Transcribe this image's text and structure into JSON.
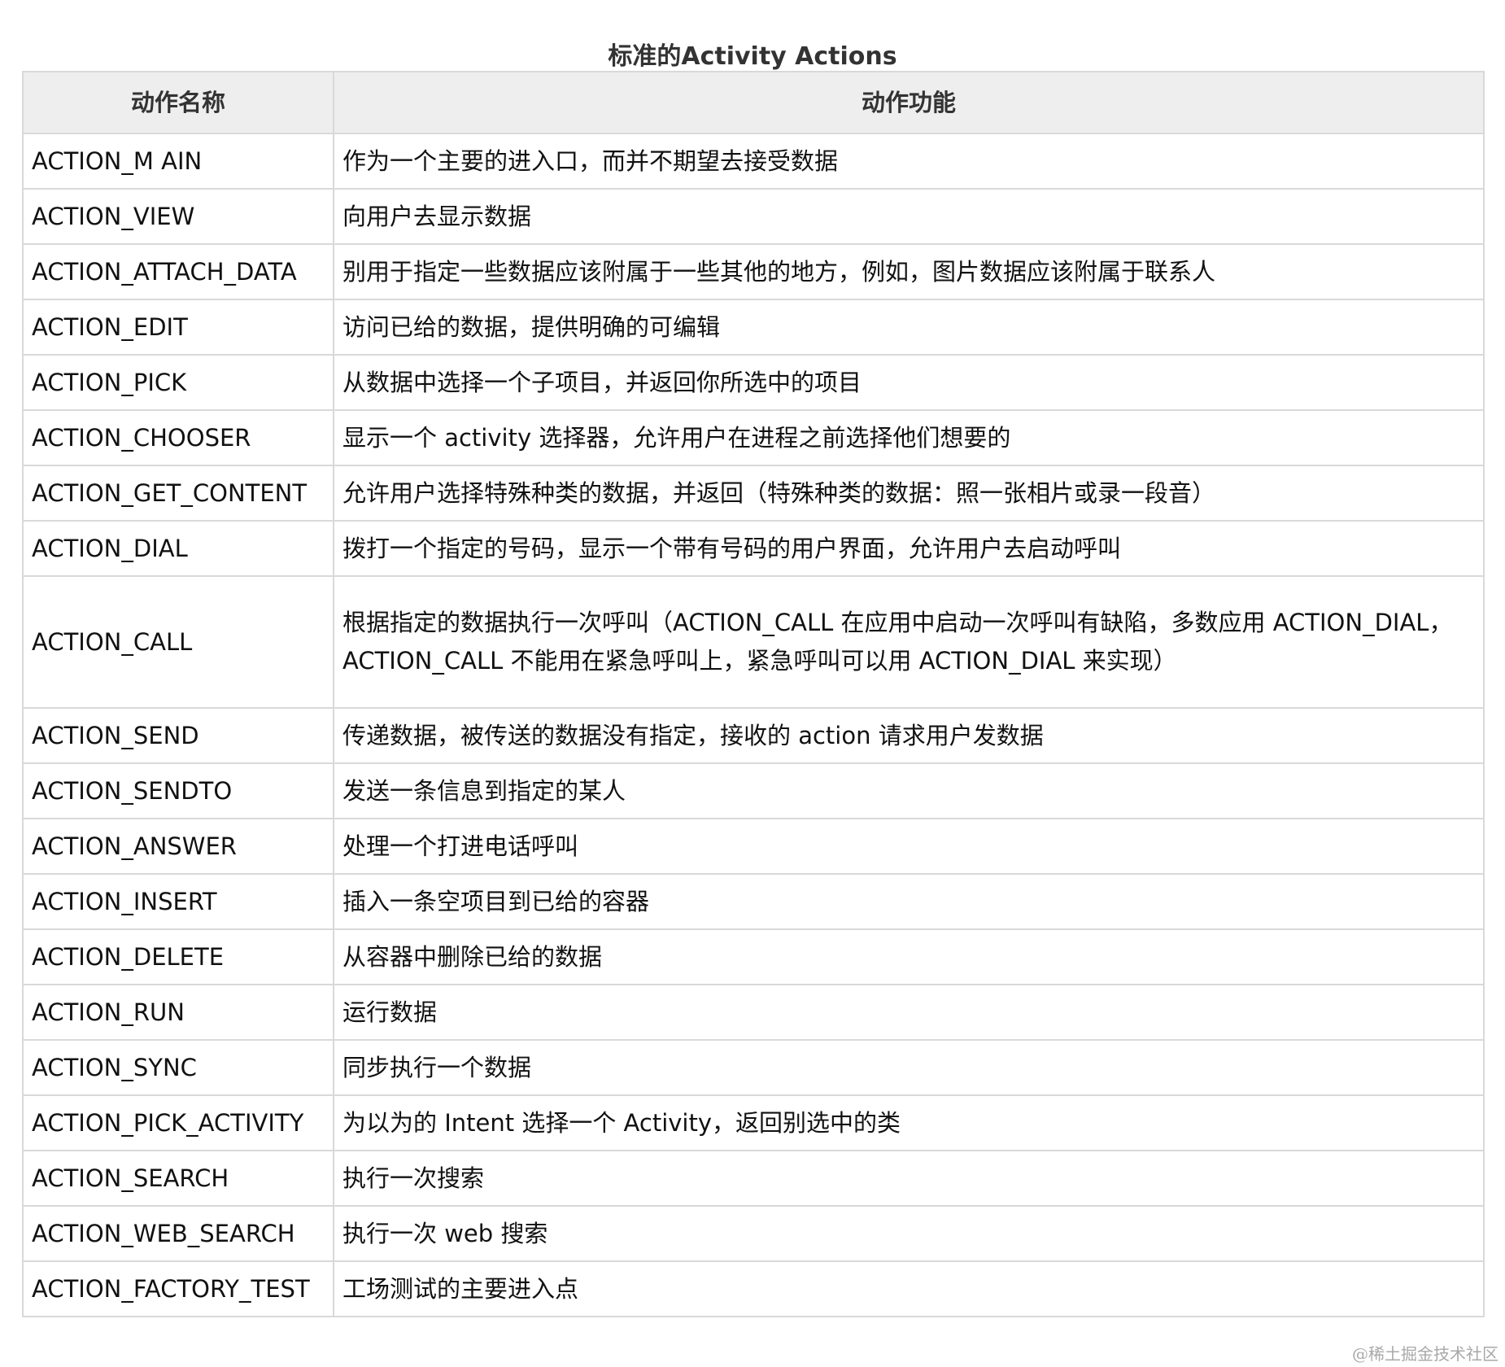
{
  "caption": "标准的Activity Actions",
  "table": {
    "headers": [
      "动作名称",
      "动作功能"
    ],
    "rows": [
      {
        "name": "ACTION_M AIN",
        "desc": "作为一个主要的进入口，而并不期望去接受数据"
      },
      {
        "name": "ACTION_VIEW",
        "desc": "向用户去显示数据"
      },
      {
        "name": "ACTION_ATTACH_DATA",
        "desc": "别用于指定一些数据应该附属于一些其他的地方，例如，图片数据应该附属于联系人"
      },
      {
        "name": "ACTION_EDIT",
        "desc": "访问已给的数据，提供明确的可编辑"
      },
      {
        "name": "ACTION_PICK",
        "desc": "从数据中选择一个子项目，并返回你所选中的项目"
      },
      {
        "name": "ACTION_CHOOSER",
        "desc": "显示一个 activity 选择器，允许用户在进程之前选择他们想要的"
      },
      {
        "name": "ACTION_GET_CONTENT",
        "desc": "允许用户选择特殊种类的数据，并返回（特殊种类的数据：照一张相片或录一段音）"
      },
      {
        "name": "ACTION_DIAL",
        "desc": "拨打一个指定的号码，显示一个带有号码的用户界面，允许用户去启动呼叫"
      },
      {
        "name": "ACTION_CALL",
        "desc": "根据指定的数据执行一次呼叫（ACTION_CALL 在应用中启动一次呼叫有缺陷，多数应用 ACTION_DIAL，ACTION_CALL 不能用在紧急呼叫上，紧急呼叫可以用 ACTION_DIAL 来实现）"
      },
      {
        "name": "ACTION_SEND",
        "desc": "传递数据，被传送的数据没有指定，接收的 action 请求用户发数据"
      },
      {
        "name": "ACTION_SENDTO",
        "desc": "发送一条信息到指定的某人"
      },
      {
        "name": "ACTION_ANSWER",
        "desc": "处理一个打进电话呼叫"
      },
      {
        "name": "ACTION_INSERT",
        "desc": "插入一条空项目到已给的容器"
      },
      {
        "name": "ACTION_DELETE",
        "desc": "从容器中删除已给的数据"
      },
      {
        "name": "ACTION_RUN",
        "desc": "运行数据"
      },
      {
        "name": "ACTION_SYNC",
        "desc": "同步执行一个数据"
      },
      {
        "name": "ACTION_PICK_ACTIVITY",
        "desc": "为以为的 Intent 选择一个 Activity，返回别选中的类"
      },
      {
        "name": "ACTION_SEARCH",
        "desc": "执行一次搜索"
      },
      {
        "name": "ACTION_WEB_SEARCH",
        "desc": "执行一次 web 搜索"
      },
      {
        "name": "ACTION_FACTORY_TEST",
        "desc": "工场测试的主要进入点"
      }
    ]
  },
  "watermark": "@稀土掘金技术社区"
}
